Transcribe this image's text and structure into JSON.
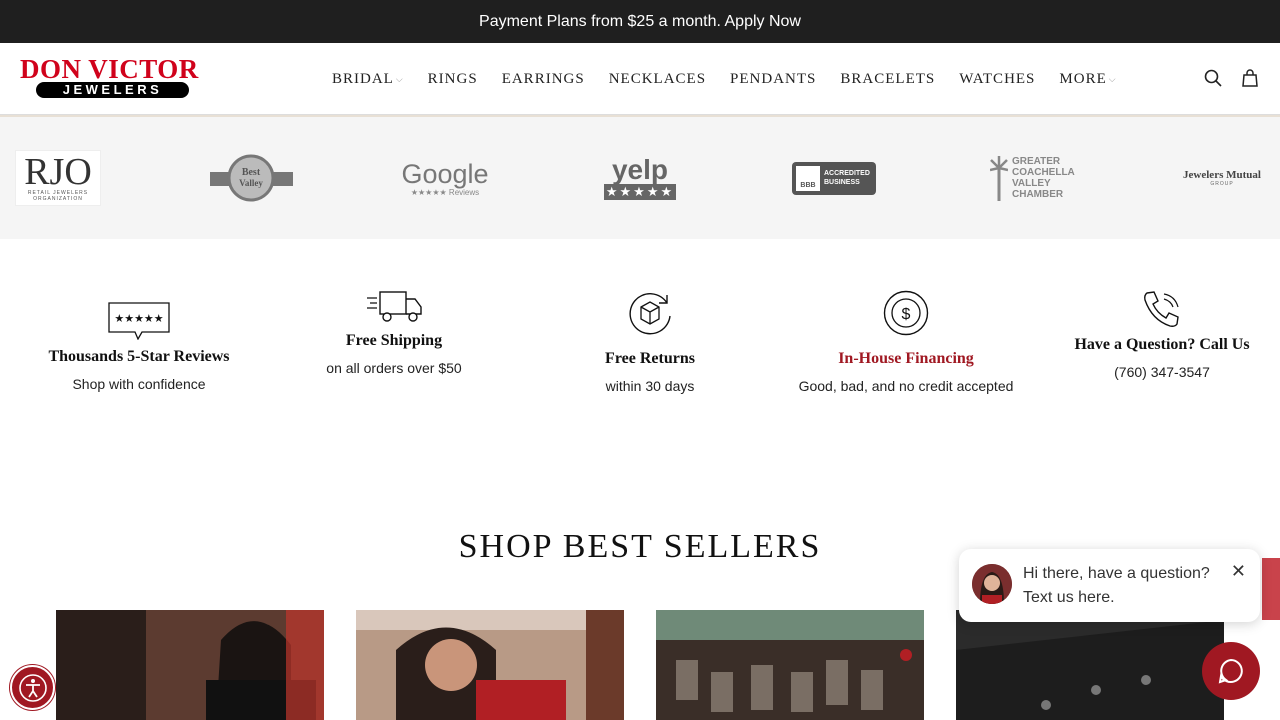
{
  "announcement": "Payment Plans from $25 a month. Apply Now",
  "logo": {
    "top": "DON VICTOR",
    "bottom": "JEWELERS"
  },
  "nav": [
    {
      "label": "BRIDAL",
      "has_dropdown": true
    },
    {
      "label": "RINGS",
      "has_dropdown": false
    },
    {
      "label": "EARRINGS",
      "has_dropdown": false
    },
    {
      "label": "NECKLACES",
      "has_dropdown": false
    },
    {
      "label": "PENDANTS",
      "has_dropdown": false
    },
    {
      "label": "BRACELETS",
      "has_dropdown": false
    },
    {
      "label": "WATCHES",
      "has_dropdown": false
    },
    {
      "label": "MORE",
      "has_dropdown": true
    }
  ],
  "header_icons": [
    "search-icon",
    "shopping-bag-icon"
  ],
  "trust_badges": [
    {
      "name": "rjo",
      "big": "RJO",
      "small": "RETAIL JEWELERS ORGANIZATION"
    },
    {
      "name": "best-of-valley",
      "big": "Best of the Valley"
    },
    {
      "name": "google",
      "big": "Google",
      "small": "★★★★★ Reviews"
    },
    {
      "name": "yelp",
      "big": "yelp",
      "small": "★★★★★"
    },
    {
      "name": "bbb",
      "big": "BBB",
      "small": "ACCREDITED BUSINESS"
    },
    {
      "name": "coachella-chamber",
      "big": "GREATER COACHELLA VALLEY CHAMBER"
    },
    {
      "name": "jewelers-mutual",
      "big": "Jewelers Mutual",
      "small": "GROUP"
    }
  ],
  "features": [
    {
      "title": "Thousands 5-Star Reviews",
      "subtitle": "Shop with confidence",
      "icon": "star-review-icon",
      "accent": false
    },
    {
      "title": "Free Shipping",
      "subtitle": "on all orders over $50",
      "icon": "truck-icon",
      "accent": false
    },
    {
      "title": "Free Returns",
      "subtitle": "within 30 days",
      "icon": "returns-box-icon",
      "accent": false
    },
    {
      "title": "In-House Financing",
      "subtitle": "Good, bad, and no credit accepted",
      "icon": "dollar-coin-icon",
      "accent": true
    },
    {
      "title": "Have a Question? Call Us",
      "subtitle": "(760) 347-3547",
      "icon": "phone-icon",
      "accent": false
    }
  ],
  "section_heading": "SHOP BEST SELLERS",
  "chat": {
    "message_line1": "Hi there, have a question?",
    "message_line2": "Text us here."
  },
  "colors": {
    "brand_red": "#a01822",
    "logo_red": "#d0021b",
    "announcement_bg": "#1f1f1f"
  }
}
